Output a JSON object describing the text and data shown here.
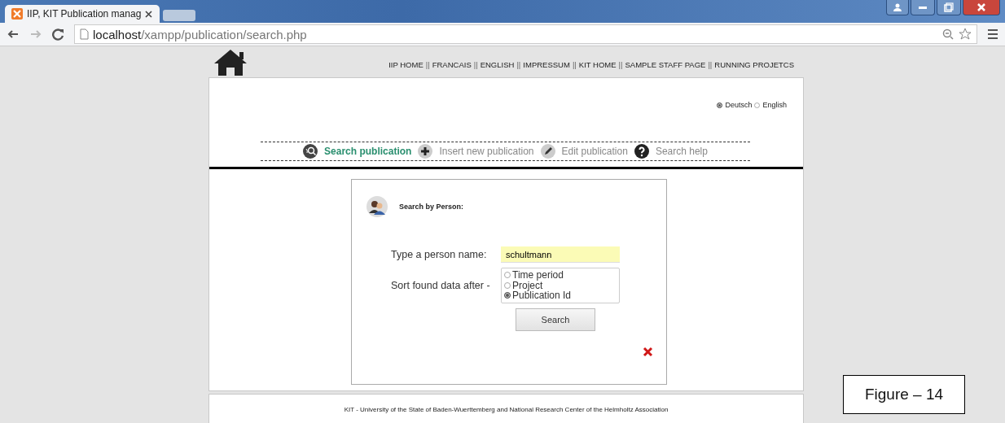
{
  "browser": {
    "tab_title": "IIP, KIT Publication manag",
    "address": {
      "host": "localhost",
      "path": "/xampp/publication/search.php"
    }
  },
  "nav": [
    {
      "kind": "link",
      "label": "IIP HOME"
    },
    {
      "kind": "sep",
      "label": "||"
    },
    {
      "kind": "link",
      "label": "FRANCAIS"
    },
    {
      "kind": "sep",
      "label": "||"
    },
    {
      "kind": "link",
      "label": "ENGLISH"
    },
    {
      "kind": "sep",
      "label": "||"
    },
    {
      "kind": "link",
      "label": "IMPRESSUM"
    },
    {
      "kind": "sep",
      "label": "||"
    },
    {
      "kind": "link",
      "label": "KIT HOME"
    },
    {
      "kind": "sep",
      "label": "||"
    },
    {
      "kind": "link",
      "label": "SAMPLE STAFF PAGE"
    },
    {
      "kind": "sep",
      "label": "||"
    },
    {
      "kind": "link",
      "label": "RUNNING PROJETCS"
    }
  ],
  "languages": [
    {
      "label": "Deutsch",
      "selected": true
    },
    {
      "label": "English",
      "selected": false
    }
  ],
  "menu": [
    {
      "label": "Search publication",
      "selected": true
    },
    {
      "label": "Insert new publication",
      "selected": false
    },
    {
      "label": "Edit publication",
      "selected": false
    },
    {
      "label": "Search help",
      "selected": false
    }
  ],
  "search_form": {
    "title": "Search by Person:",
    "name_label": "Type a person name:",
    "name_value": "schultmann",
    "sort_label": "Sort found data after -",
    "sort_options": [
      {
        "label": "Time period",
        "selected": false
      },
      {
        "label": "Project",
        "selected": false
      },
      {
        "label": "Publication Id",
        "selected": true
      }
    ],
    "button": "Search"
  },
  "footer": "KIT - University of the State of Baden-Wuerttemberg and National Research Center of the Helmholtz Association",
  "figure_label": "Figure – 14"
}
